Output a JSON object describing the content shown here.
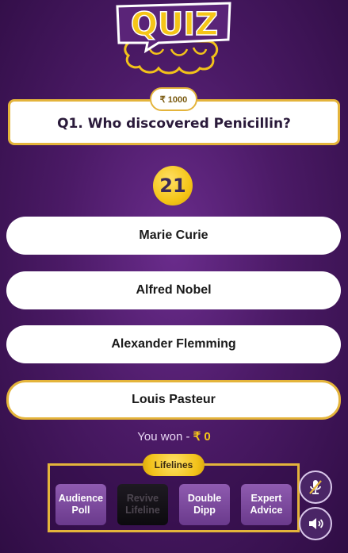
{
  "logo": {
    "text": "QUIZ"
  },
  "question": {
    "prize": "₹ 1000",
    "text": "Q1. Who discovered Penicillin?"
  },
  "timer": {
    "seconds": "21"
  },
  "options": [
    {
      "label": "Marie Curie",
      "selected": false
    },
    {
      "label": "Alfred Nobel",
      "selected": false
    },
    {
      "label": "Alexander Flemming",
      "selected": false
    },
    {
      "label": "Louis Pasteur",
      "selected": true
    }
  ],
  "winnings": {
    "label": "You won - ",
    "amount": "₹ 0"
  },
  "lifelines": {
    "title": "Lifelines",
    "items": [
      {
        "line1": "Audience",
        "line2": "Poll",
        "enabled": true
      },
      {
        "line1": "Revive",
        "line2": "Lifeline",
        "enabled": false
      },
      {
        "line1": "Double",
        "line2": "Dipp",
        "enabled": true
      },
      {
        "line1": "Expert",
        "line2": "Advice",
        "enabled": true
      }
    ]
  },
  "controls": {
    "mic": {
      "icon": "mic-muted-icon"
    },
    "sound": {
      "icon": "speaker-icon"
    }
  },
  "colors": {
    "accent_gold": "#e4b43b",
    "timer_yellow": "#f5c518",
    "background_purple": "#4b1a66",
    "lifeline_purple": "#7a4a9c"
  }
}
